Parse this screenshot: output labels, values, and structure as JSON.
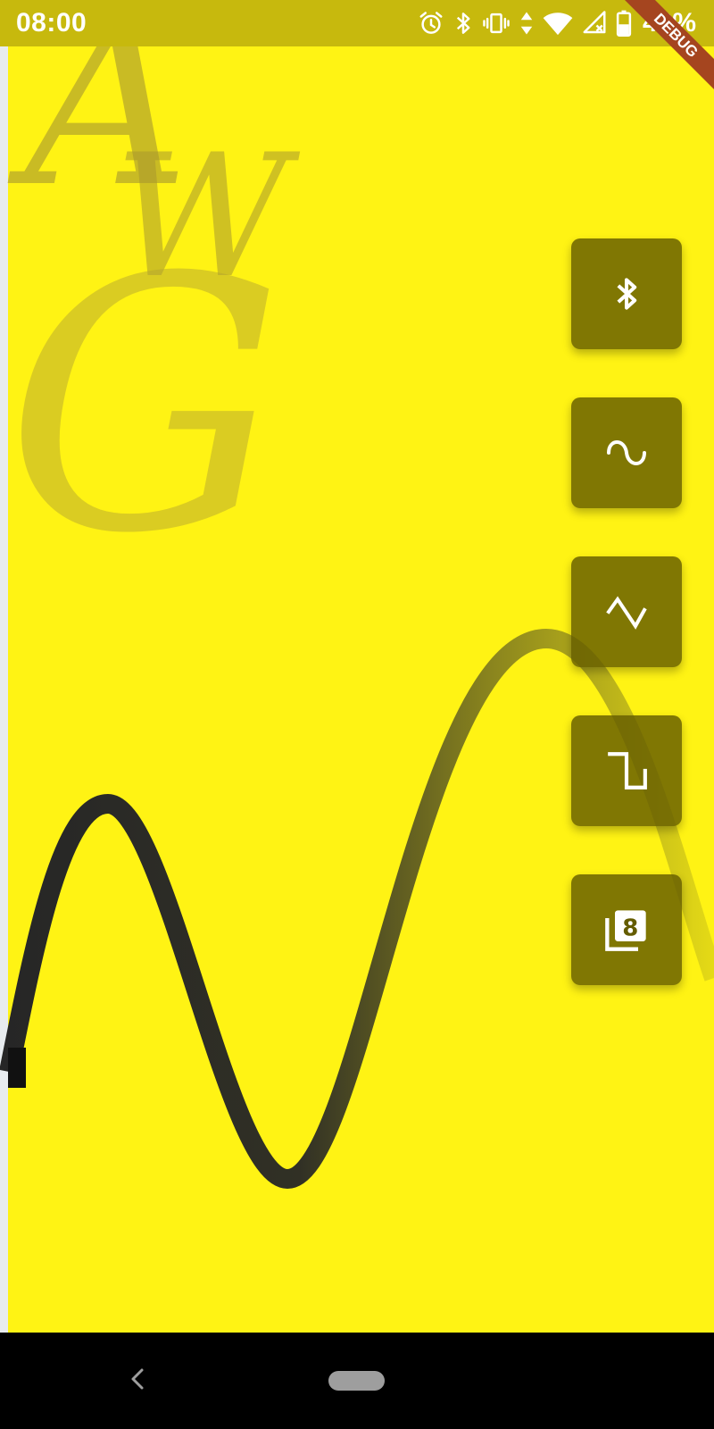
{
  "status_bar": {
    "time": "08:00",
    "battery_percent": "42%",
    "icons": [
      "alarm-icon",
      "bluetooth-icon",
      "vibrate-icon",
      "data-arrows-icon",
      "wifi-icon",
      "no-signal-icon",
      "battery-icon"
    ]
  },
  "debug_banner": {
    "label": "DEBUG"
  },
  "logo": {
    "letters": [
      "A",
      "W",
      "G"
    ]
  },
  "wave_buttons": [
    {
      "icon": "bluetooth-icon"
    },
    {
      "icon": "sine-wave-icon"
    },
    {
      "icon": "triangle-wave-icon"
    },
    {
      "icon": "square-wave-icon"
    },
    {
      "icon": "filter-8-icon",
      "icon_text": "8"
    }
  ],
  "nav_bar": {
    "icons": [
      "back-icon",
      "home-icon"
    ]
  },
  "colors": {
    "background": "#fff314",
    "status_bar": "#c7b90d",
    "button_fill": "#645c00",
    "wave_stroke": "#262626",
    "debug_ribbon": "#a5451f",
    "logo_tint": "#b8a82a"
  }
}
